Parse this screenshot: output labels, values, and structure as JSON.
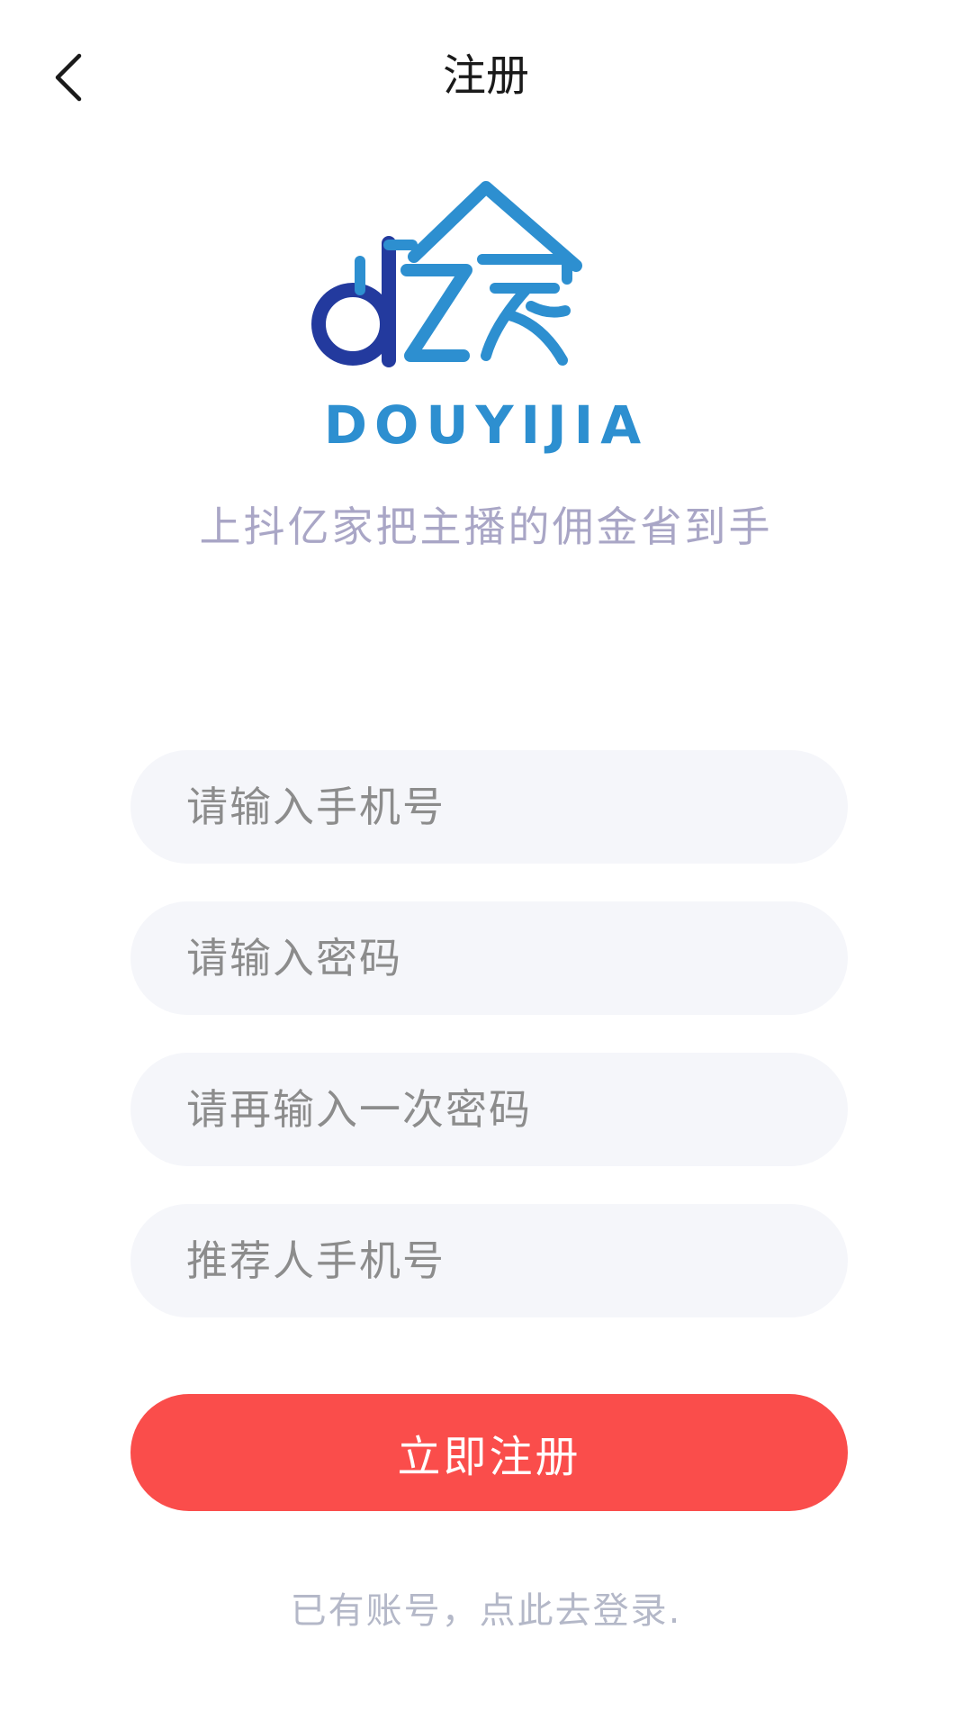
{
  "header": {
    "title": "注册",
    "back_icon": "chevron-left-icon"
  },
  "brand": {
    "logo_text": "DOUYIJIA",
    "logo_mark": "亿家",
    "slogan": "上抖亿家把主播的佣金省到手",
    "colors": {
      "dark_blue": "#233a9e",
      "light_blue": "#2d8fd0"
    }
  },
  "form": {
    "phone_placeholder": "请输入手机号",
    "password_placeholder": "请输入密码",
    "password_confirm_placeholder": "请再输入一次密码",
    "referrer_placeholder": "推荐人手机号",
    "submit_label": "立即注册",
    "submit_color": "#fa4d4b"
  },
  "footer": {
    "login_link": "已有账号，点此去登录."
  }
}
